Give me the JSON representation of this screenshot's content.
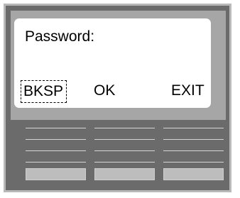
{
  "screen": {
    "prompt": "Password:"
  },
  "softkeys": {
    "left": "BKSP",
    "middle": "OK",
    "right": "EXIT"
  }
}
